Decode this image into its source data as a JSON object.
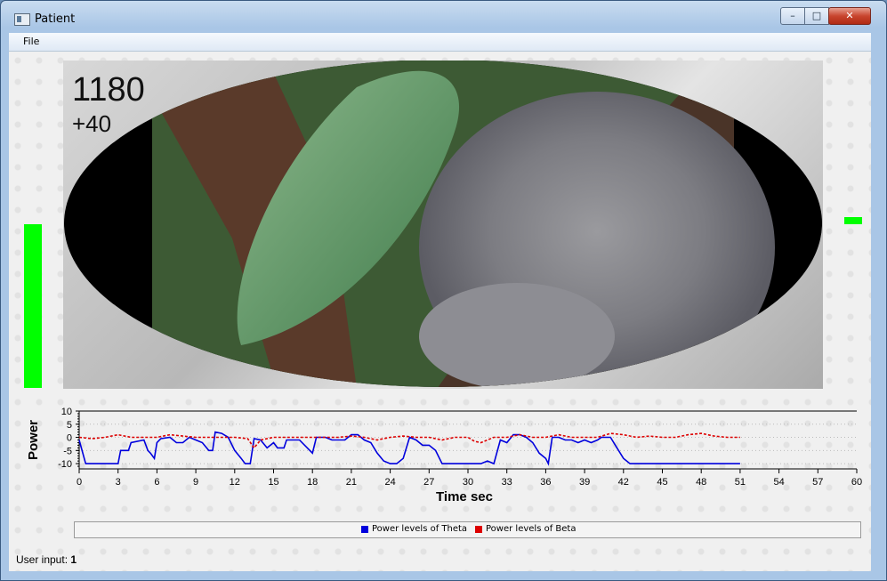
{
  "window": {
    "title": "Patient",
    "minimize_glyph": "–",
    "maximize_glyph": "□",
    "close_glyph": "✕"
  },
  "menu": {
    "file": "File"
  },
  "overlay": {
    "score": "1180",
    "delta": "+40"
  },
  "meters": {
    "left_level": 0.5,
    "right_level": 0.02,
    "color": "#00ff00"
  },
  "user_input": {
    "label": "User input:",
    "value": "1"
  },
  "chart_data": {
    "type": "line",
    "xlabel": "Time sec",
    "ylabel": "Power",
    "xlim": [
      0,
      60
    ],
    "ylim": [
      -12,
      10
    ],
    "xticks": [
      0,
      3,
      6,
      9,
      12,
      15,
      18,
      21,
      24,
      27,
      30,
      33,
      36,
      39,
      42,
      45,
      48,
      51,
      54,
      57,
      60
    ],
    "yticks": [
      10,
      5,
      0,
      -5,
      -10
    ],
    "legend_position": "bottom",
    "series": [
      {
        "name": "Power levels of Theta",
        "color": "#0000dd",
        "style": "solid",
        "points": [
          [
            0,
            -1
          ],
          [
            0.5,
            -10
          ],
          [
            3,
            -10
          ],
          [
            3.2,
            -5
          ],
          [
            3.8,
            -5
          ],
          [
            4,
            -2
          ],
          [
            5,
            -1
          ],
          [
            5.3,
            -5
          ],
          [
            5.5,
            -6
          ],
          [
            5.8,
            -8
          ],
          [
            6,
            -2
          ],
          [
            6.3,
            -0.5
          ],
          [
            7,
            0
          ],
          [
            7.5,
            -2
          ],
          [
            8,
            -2
          ],
          [
            8.5,
            0
          ],
          [
            9,
            -1
          ],
          [
            9.5,
            -2
          ],
          [
            10,
            -5
          ],
          [
            10.3,
            -5
          ],
          [
            10.5,
            2
          ],
          [
            11,
            1.5
          ],
          [
            11.5,
            0
          ],
          [
            12,
            -5
          ],
          [
            12.5,
            -8
          ],
          [
            12.8,
            -10
          ],
          [
            13.2,
            -10
          ],
          [
            13.5,
            -0.5
          ],
          [
            14,
            -1
          ],
          [
            14.5,
            -4
          ],
          [
            15,
            -2
          ],
          [
            15.3,
            -4
          ],
          [
            15.8,
            -4
          ],
          [
            16,
            -1
          ],
          [
            17,
            -1
          ],
          [
            18,
            -6
          ],
          [
            18.3,
            0
          ],
          [
            19,
            0
          ],
          [
            19.5,
            -1
          ],
          [
            20,
            -1
          ],
          [
            20.5,
            -1
          ],
          [
            21,
            1
          ],
          [
            21.5,
            1
          ],
          [
            22,
            -1
          ],
          [
            22.5,
            -2
          ],
          [
            23,
            -6
          ],
          [
            23.5,
            -9
          ],
          [
            24,
            -10
          ],
          [
            24.5,
            -10
          ],
          [
            25,
            -8
          ],
          [
            25.5,
            0
          ],
          [
            26,
            -1
          ],
          [
            26.5,
            -3
          ],
          [
            27,
            -3
          ],
          [
            27.5,
            -5
          ],
          [
            28,
            -10
          ],
          [
            30,
            -10
          ],
          [
            31,
            -10
          ],
          [
            31.5,
            -9
          ],
          [
            32,
            -10
          ],
          [
            32.5,
            -1
          ],
          [
            33,
            -2
          ],
          [
            33.5,
            1
          ],
          [
            34,
            1
          ],
          [
            34.5,
            0
          ],
          [
            35,
            -2
          ],
          [
            35.5,
            -6
          ],
          [
            36,
            -8
          ],
          [
            36.2,
            -10
          ],
          [
            36.5,
            0
          ],
          [
            37,
            0
          ],
          [
            37.5,
            -1
          ],
          [
            38,
            -1
          ],
          [
            38.5,
            -2
          ],
          [
            39,
            -1
          ],
          [
            39.5,
            -2
          ],
          [
            40,
            -1
          ],
          [
            40.3,
            0
          ],
          [
            41,
            0
          ],
          [
            41.5,
            -4
          ],
          [
            42,
            -8
          ],
          [
            42.5,
            -10
          ],
          [
            51,
            -10
          ]
        ]
      },
      {
        "name": "Power levels of Beta",
        "color": "#dd0000",
        "style": "dashed",
        "points": [
          [
            0,
            0
          ],
          [
            1,
            -0.5
          ],
          [
            2,
            0
          ],
          [
            3,
            1
          ],
          [
            4,
            0
          ],
          [
            5,
            0
          ],
          [
            6,
            0
          ],
          [
            7,
            1
          ],
          [
            8,
            0.5
          ],
          [
            9,
            0
          ],
          [
            10,
            0
          ],
          [
            11,
            0
          ],
          [
            12,
            0
          ],
          [
            13,
            -0.5
          ],
          [
            13.5,
            -4
          ],
          [
            14,
            -1
          ],
          [
            15,
            0
          ],
          [
            16,
            0
          ],
          [
            17,
            0
          ],
          [
            18,
            0
          ],
          [
            19,
            0
          ],
          [
            20,
            0
          ],
          [
            21,
            0.5
          ],
          [
            22,
            0
          ],
          [
            23,
            -1
          ],
          [
            24,
            0
          ],
          [
            25,
            0.5
          ],
          [
            26,
            0
          ],
          [
            27,
            0
          ],
          [
            28,
            -1
          ],
          [
            29,
            0
          ],
          [
            30,
            0
          ],
          [
            30.5,
            -1.5
          ],
          [
            31,
            -2
          ],
          [
            32,
            0
          ],
          [
            33,
            0
          ],
          [
            34,
            1
          ],
          [
            35,
            0
          ],
          [
            36,
            0
          ],
          [
            37,
            1
          ],
          [
            38,
            0
          ],
          [
            39,
            0
          ],
          [
            40,
            0
          ],
          [
            41,
            1.5
          ],
          [
            42,
            1
          ],
          [
            43,
            0
          ],
          [
            44,
            0.5
          ],
          [
            45,
            0
          ],
          [
            46,
            0
          ],
          [
            47,
            1
          ],
          [
            48,
            1.5
          ],
          [
            49,
            0.5
          ],
          [
            50,
            0
          ],
          [
            51,
            0
          ]
        ]
      }
    ]
  }
}
